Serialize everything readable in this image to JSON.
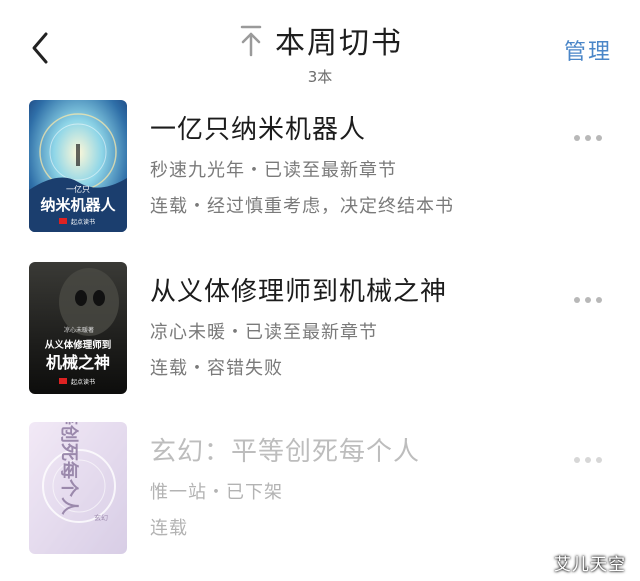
{
  "header": {
    "title": "本周切书",
    "count": "3本",
    "manage_label": "管理",
    "back_icon": "chevron-left-icon",
    "sort_icon": "arrow-up-icon"
  },
  "books": [
    {
      "title": "一亿只纳米机器人",
      "meta": "秒速九光年・已读至最新章节",
      "status": "连载・经过慎重考虑，决定终结本书",
      "cover": {
        "small": "一亿只",
        "big": "纳米机器人",
        "brand": "起点读书"
      }
    },
    {
      "title": "从义体修理师到机械之神",
      "meta": "凉心未暖・已读至最新章节",
      "status": "连载・容错失败",
      "cover": {
        "small": "凉心未暖著",
        "line1": "从义体修理师到",
        "big": "机械之神",
        "brand": "起点读书"
      }
    },
    {
      "title": "玄幻：平等创死每个人",
      "meta": "惟一站・已下架",
      "status": "连载",
      "cover": {
        "big": "平等创死每个人",
        "tag": "玄幻"
      }
    }
  ],
  "watermark": "艾儿天空",
  "colors": {
    "accent": "#4a86c8",
    "muted": "#7a7a7a",
    "disabled": "#bdbdbd"
  }
}
